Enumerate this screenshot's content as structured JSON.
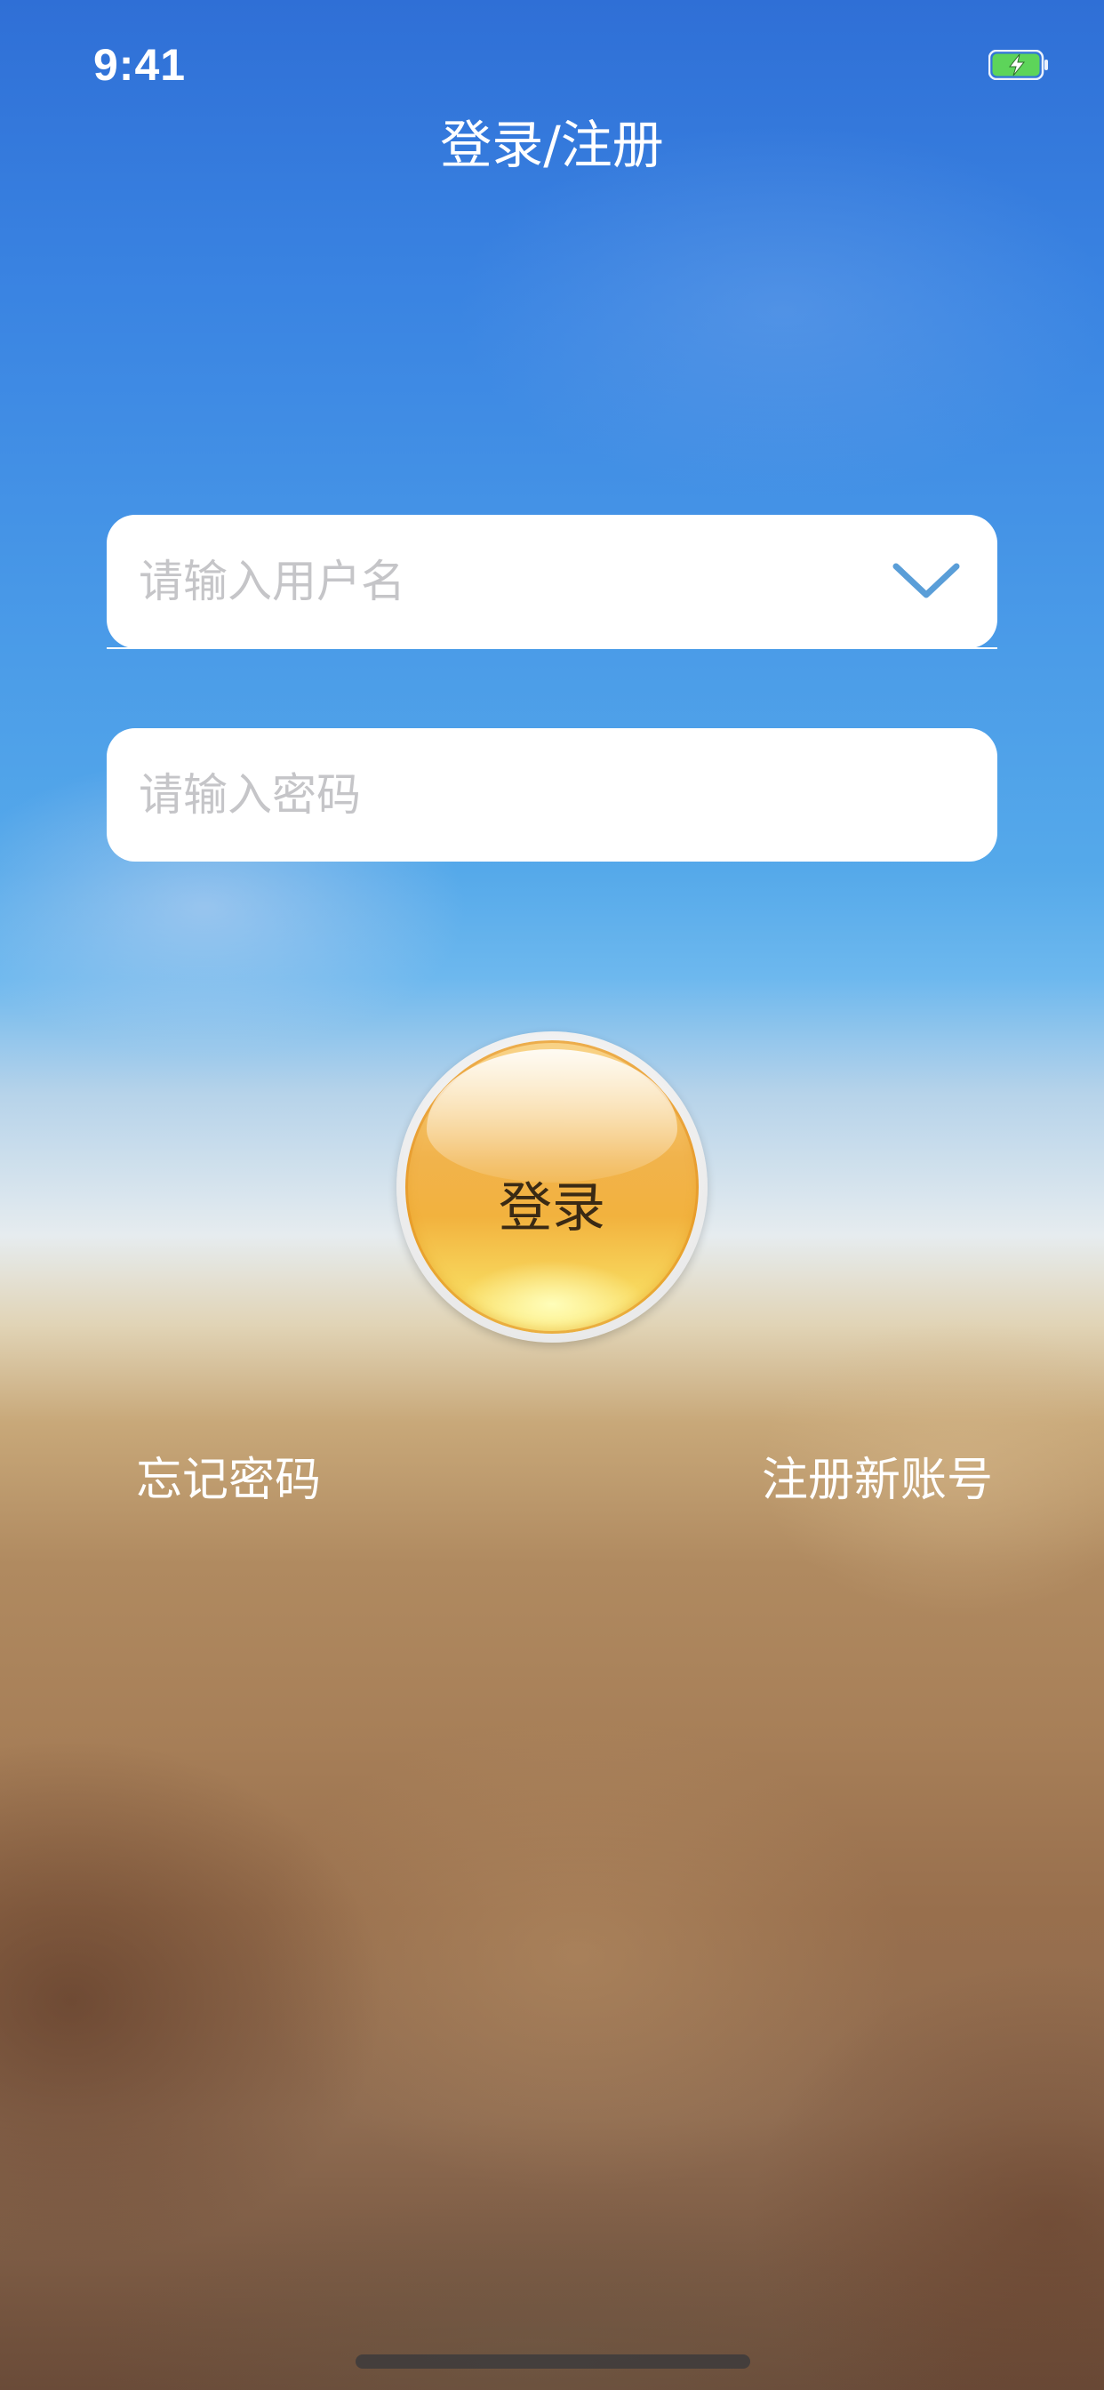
{
  "status_bar": {
    "time": "9:41",
    "battery_icon": "battery-charging-icon",
    "battery_color": "#5dd45a"
  },
  "nav": {
    "title": "登录/注册"
  },
  "form": {
    "username": {
      "placeholder": "请输入用户名",
      "value": "",
      "dropdown_icon": "chevron-down-icon",
      "chevron_color": "#5a9ed8"
    },
    "password": {
      "placeholder": "请输入密码",
      "value": ""
    }
  },
  "login_button": {
    "label": "登录",
    "color": "#f2b23e"
  },
  "links": {
    "forgot_password": "忘记密码",
    "register": "注册新账号"
  }
}
